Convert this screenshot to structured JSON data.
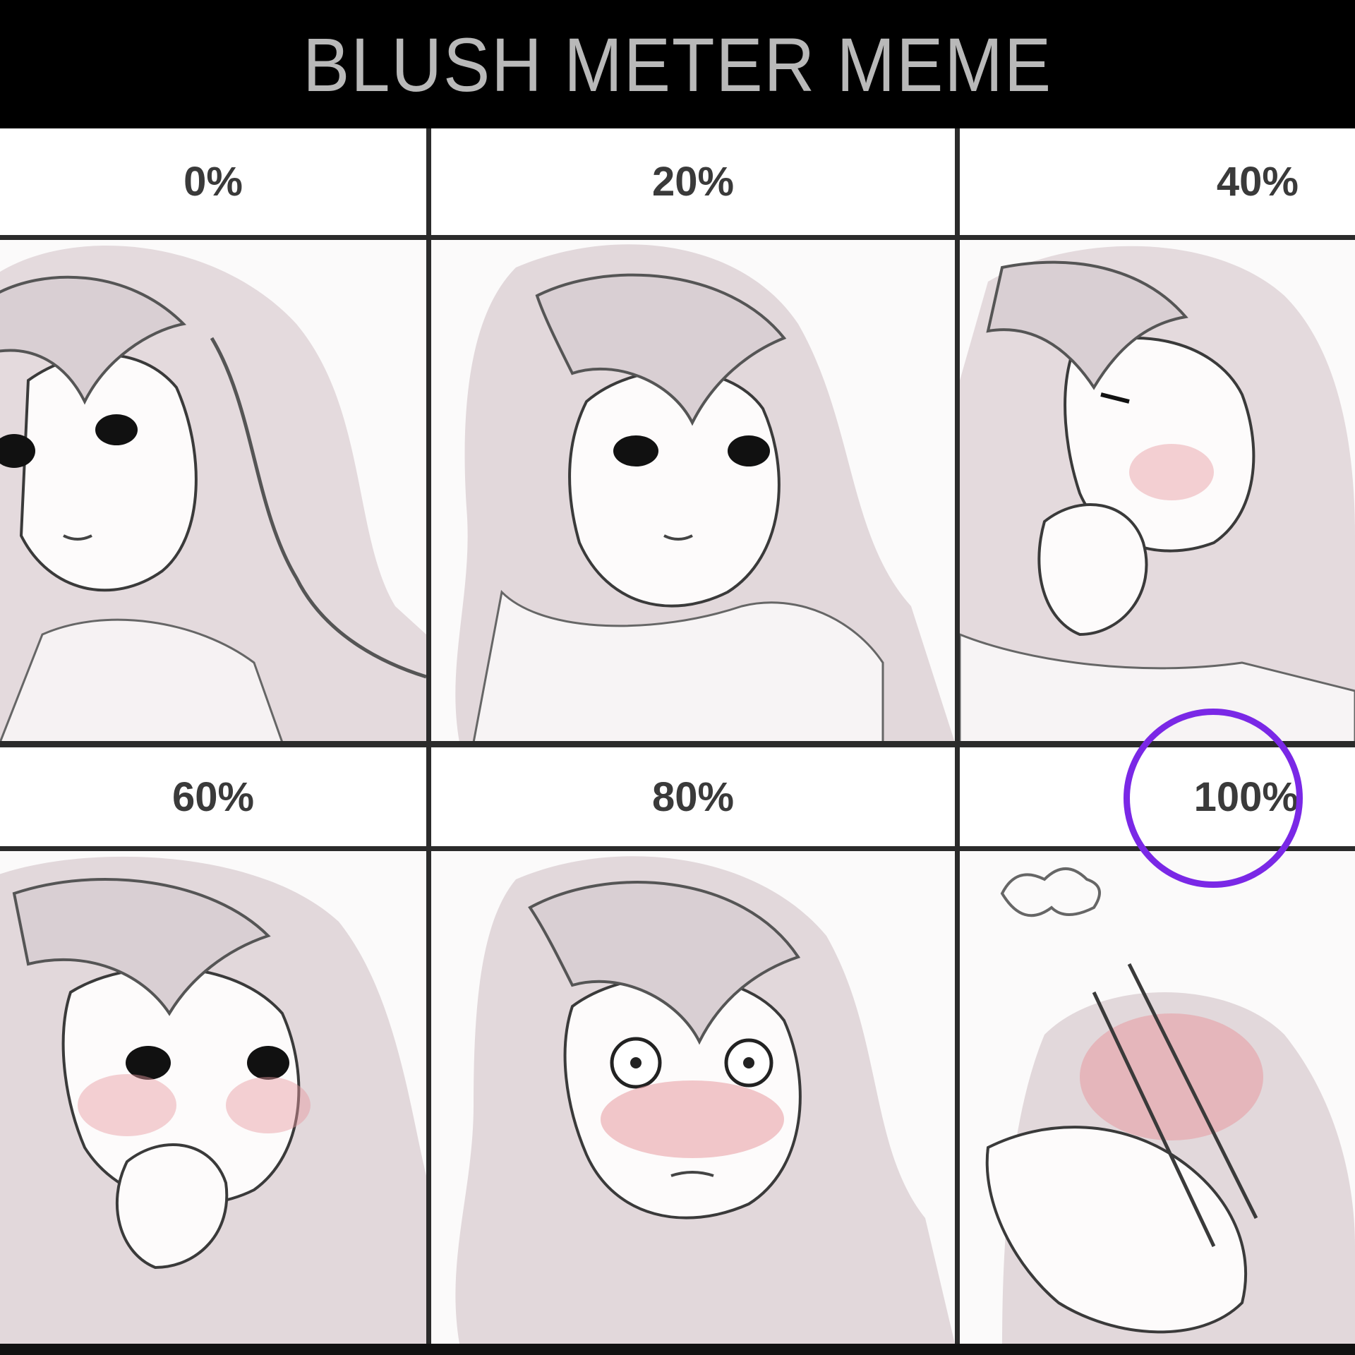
{
  "title": "BLUSH METER MEME",
  "levels": [
    "0%",
    "20%",
    "40%",
    "60%",
    "80%",
    "100%"
  ],
  "highlight": {
    "level": "100%",
    "color": "#7a28e6"
  },
  "colors": {
    "hair": "#d9cfd3",
    "hair_shade": "#b7a9ae",
    "blush": "#e79aa0",
    "line": "#2b2b2b",
    "skin": "#fdfbfb"
  }
}
